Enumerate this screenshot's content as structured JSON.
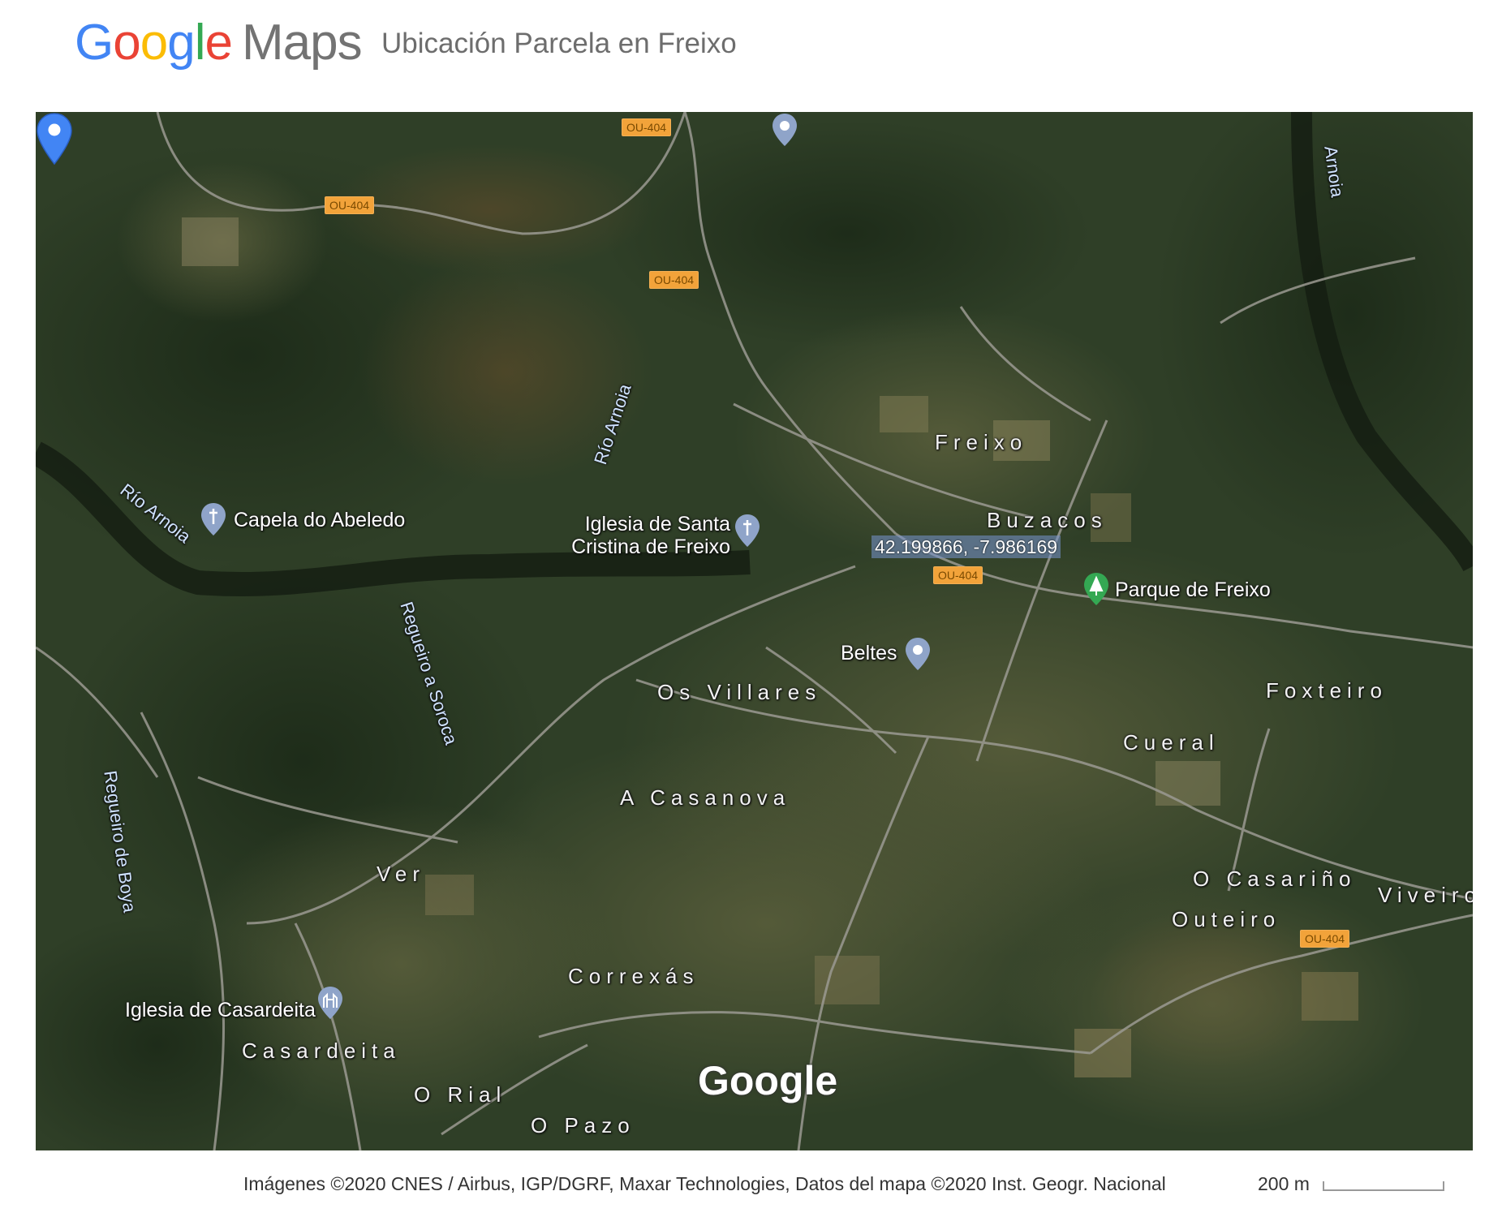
{
  "header": {
    "logo_letters": [
      "G",
      "o",
      "o",
      "g",
      "l",
      "e"
    ],
    "logo_product": "Maps",
    "title": "Ubicación Parcela en Freixo"
  },
  "map": {
    "view": "satellite",
    "watermark": "Google",
    "marker": {
      "coordinates_label": "42.199866, -7.986169",
      "color": "#4285F4"
    },
    "places": [
      "Freixo",
      "Buzacos",
      "Os Villares",
      "Foxteiro",
      "Cueral",
      "A Casanova",
      "Ver",
      "O Casariño",
      "Outeiro",
      "Viveiro",
      "Correxás",
      "Casardeita",
      "O Rial",
      "O Pazo"
    ],
    "pois": [
      "Capela do Abeledo",
      "Iglesia de Santa Cristina de Freixo",
      "Beltes",
      "Parque de Freixo",
      "Iglesia de Casardeita"
    ],
    "waterways": [
      "Río Arnoia",
      "Río Arnoia",
      "Regueiro a Soroca",
      "Regueiro de Boya",
      "Arnoia"
    ],
    "road_shields": [
      "OU-404",
      "OU-404",
      "OU-404",
      "OU-404",
      "OU-404"
    ]
  },
  "footer": {
    "attribution": "Imágenes ©2020 CNES / Airbus, IGP/DGRF, Maxar Technologies, Datos del mapa ©2020 Inst. Geogr. Nacional",
    "scale_label": "200 m"
  }
}
